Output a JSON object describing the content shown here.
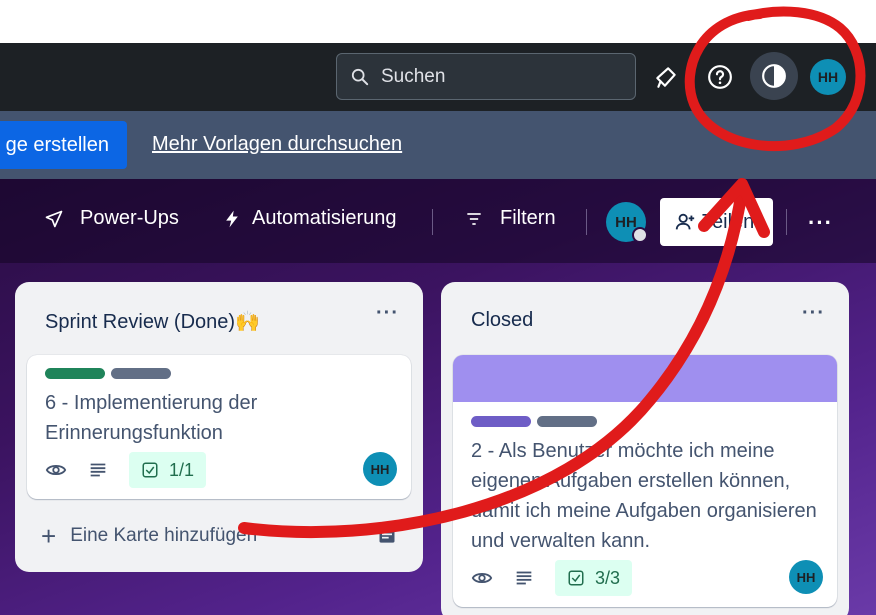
{
  "header": {
    "search_placeholder": "Suchen",
    "avatar_initials": "HH"
  },
  "banner": {
    "create_button": "ge erstellen",
    "browse_link": "Mehr Vorlagen durchsuchen"
  },
  "toolbar": {
    "powerups": "Power-Ups",
    "automation": "Automatisierung",
    "filter": "Filtern",
    "avatar_initials": "HH",
    "share": "Teilen",
    "more": "···"
  },
  "lists": [
    {
      "title": "Sprint Review (Done)🙌",
      "more": "···",
      "cards": [
        {
          "labels": [
            "#1f845a",
            "#626f86"
          ],
          "title": "6 - Implementierung der Erinnerungsfunktion",
          "checklist": "1/1",
          "avatar": "HH"
        }
      ],
      "add_card": "Eine Karte hinzufügen"
    },
    {
      "title": "Closed",
      "more": "···",
      "cards": [
        {
          "cover_color": "#9f8fef",
          "labels": [
            "#6e5dc6",
            "#626f86"
          ],
          "title": "2 - Als Benutzer möchte ich meine eigenen Aufgaben erstellen können, damit ich meine Aufgaben organisieren und verwalten kann.",
          "checklist": "3/3",
          "avatar": "HH"
        }
      ]
    }
  ],
  "colors": {
    "header_bg": "#1d2125",
    "banner_bg": "#44546f",
    "primary_button": "#0c66e4",
    "annotation_red": "#e01b1b"
  }
}
